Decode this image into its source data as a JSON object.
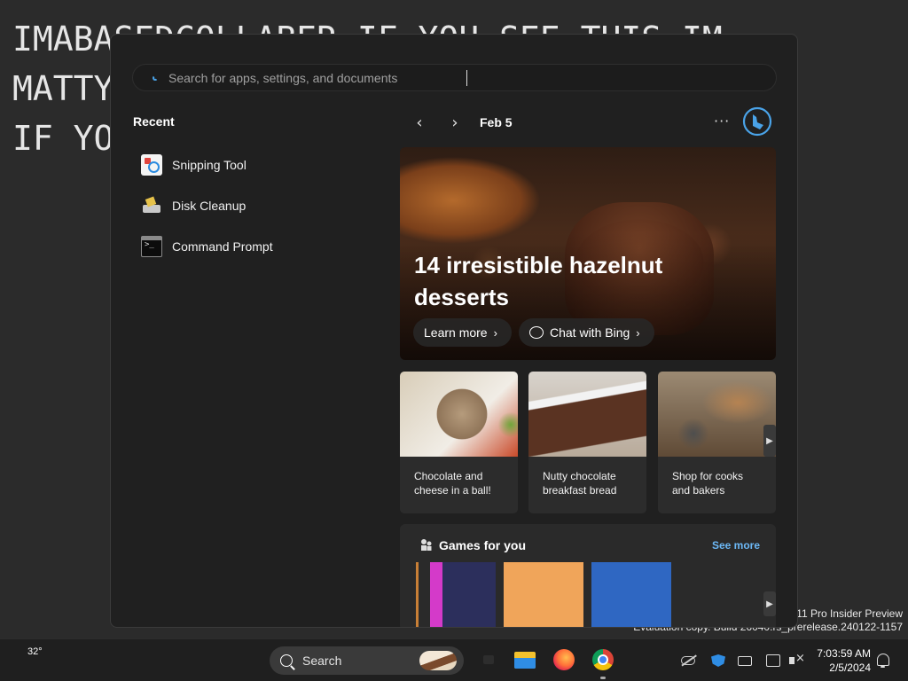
{
  "desktop": {
    "lines": [
      "IMABASEDCOLLABER IF YOU SEE THIS IM",
      "MATTY",
      "IF YO"
    ],
    "watermark_line1": "s 11 Pro Insider Preview",
    "watermark_line2": "Evaluation copy. Build 26040.rs_prerelease.240122-1157"
  },
  "search": {
    "placeholder": "Search for apps, settings, and documents"
  },
  "recent": {
    "title": "Recent",
    "items": [
      {
        "label": "Snipping Tool",
        "icon": "snipping-tool-icon"
      },
      {
        "label": "Disk Cleanup",
        "icon": "disk-cleanup-icon"
      },
      {
        "label": "Command Prompt",
        "icon": "command-prompt-icon"
      }
    ]
  },
  "highlights": {
    "date": "Feb 5",
    "more": "···",
    "hero": {
      "title": "14 irresistible hazelnut desserts",
      "learn_more": "Learn more",
      "chat": "Chat with Bing"
    },
    "cards": [
      {
        "caption": "Chocolate and cheese in a ball!"
      },
      {
        "caption": "Nutty chocolate breakfast bread"
      },
      {
        "caption": "Shop for cooks and bakers"
      }
    ],
    "games": {
      "title": "Games for you",
      "see_more": "See more"
    }
  },
  "taskbar": {
    "weather": "32°",
    "search_label": "Search",
    "time": "7:03:59 AM",
    "date": "2/5/2024"
  },
  "colors": {
    "accent": "#6cb8f6",
    "flyout_bg": "#202020",
    "taskbar_bg": "#1f1f1f"
  }
}
